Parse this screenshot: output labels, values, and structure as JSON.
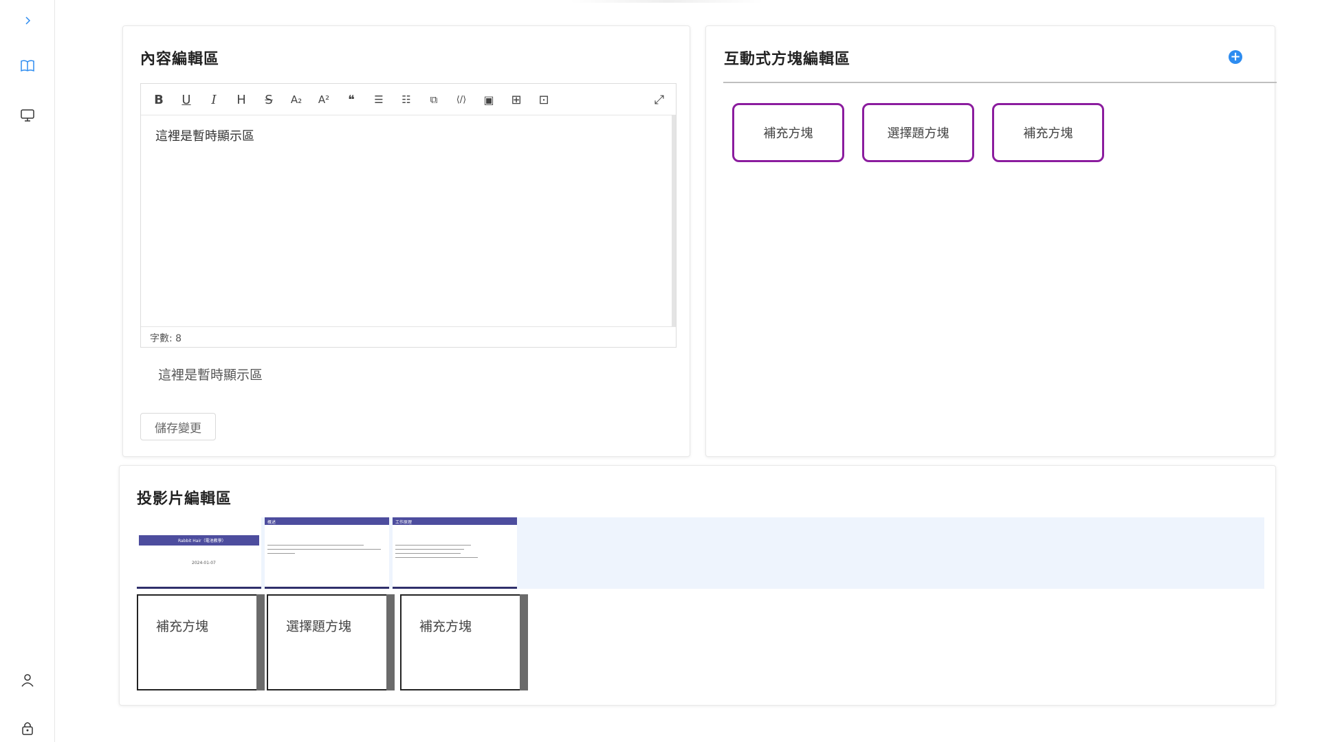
{
  "content_editor": {
    "title": "內容編輯區",
    "editor_text": "這裡是暫時顯示區",
    "word_count": "字數: 8",
    "preview_text": "這裡是暫時顯示區",
    "save_label": "儲存變更",
    "toolbar": [
      {
        "name": "bold-icon",
        "glyph": "B"
      },
      {
        "name": "underline-icon",
        "glyph": "U"
      },
      {
        "name": "italic-icon",
        "glyph": "I"
      },
      {
        "name": "heading-icon",
        "glyph": "H"
      },
      {
        "name": "strikethrough-icon",
        "glyph": "S"
      },
      {
        "name": "subscript-icon",
        "glyph": "A₂"
      },
      {
        "name": "superscript-icon",
        "glyph": "A²"
      },
      {
        "name": "quote-icon",
        "glyph": "❝"
      },
      {
        "name": "bullet-list-icon",
        "glyph": "☰"
      },
      {
        "name": "ordered-list-icon",
        "glyph": "☷"
      },
      {
        "name": "code-block-icon",
        "glyph": "⧉"
      },
      {
        "name": "inline-code-icon",
        "glyph": "⟨/⟩"
      },
      {
        "name": "image-icon",
        "glyph": "▣"
      },
      {
        "name": "table-icon",
        "glyph": "⊞"
      },
      {
        "name": "save-icon",
        "glyph": "⊡"
      }
    ],
    "fullscreen_glyph": "⤢"
  },
  "interactive_blocks": {
    "title": "互動式方塊編輯區",
    "add_glyph": "+",
    "blocks": [
      "補充方塊",
      "選擇題方塊",
      "補充方塊"
    ]
  },
  "slide_editor": {
    "title": "投影片編輯區",
    "slides": [
      {
        "header": "",
        "title": "Rabbit Hair（電池教學）",
        "date": "2024-01-07"
      },
      {
        "header": "概述",
        "title": "",
        "date": ""
      },
      {
        "header": "工作原理",
        "title": "",
        "date": ""
      }
    ],
    "blocks": [
      "補充方塊",
      "選擇題方塊",
      "補充方塊"
    ]
  },
  "sidebar": {
    "icons": [
      "chevron-right-icon",
      "book-icon",
      "monitor-icon",
      "user-icon",
      "lock-icon"
    ]
  },
  "colors": {
    "accent_blue": "#2d8cf0",
    "block_border": "#8b1c9e",
    "slide_header": "#4d4d9e",
    "strip_bg": "#eef4fd"
  }
}
